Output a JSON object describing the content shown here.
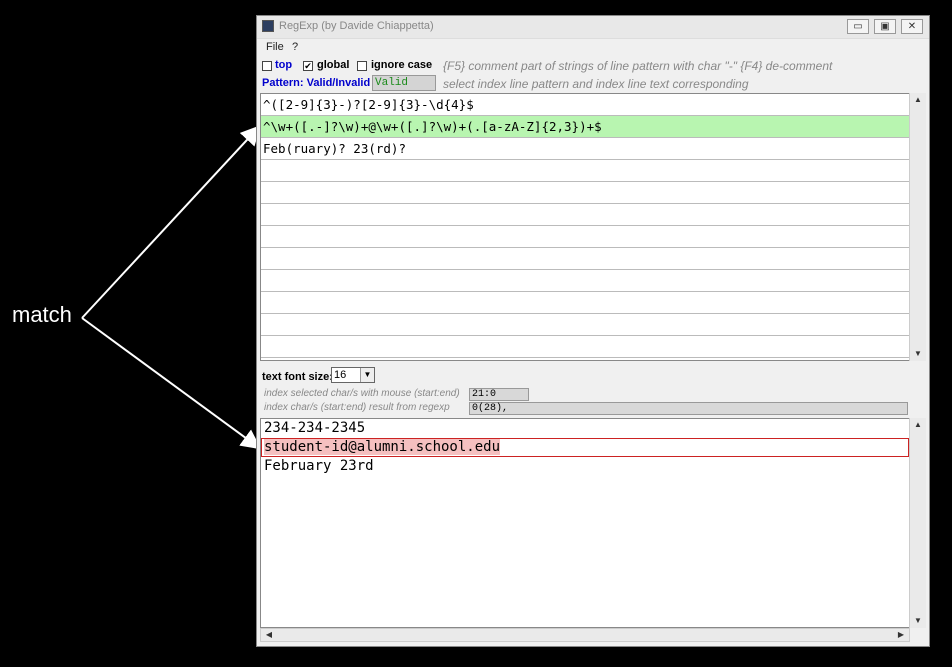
{
  "annotation": {
    "label": "match"
  },
  "window": {
    "title": "RegExp (by Davide Chiappetta)",
    "controls": {
      "minimize": "▭",
      "maximize": "▣",
      "close": "✕"
    }
  },
  "menu": {
    "file": "File",
    "help": "?"
  },
  "options": {
    "top": {
      "label": "top",
      "checked": false
    },
    "global": {
      "label": "global",
      "checked": true
    },
    "ignore_case": {
      "label": "ignore case",
      "checked": false
    },
    "hint": "{F5} comment part of strings of line pattern with char \"-\" {F4} de-comment"
  },
  "pattern": {
    "label": "Pattern: Valid/Invalid",
    "status": "Valid",
    "hint": "select index line pattern and index line text  corresponding",
    "rows": [
      "^([2-9]{3}-)?[2-9]{3}-\\d{4}$",
      "^\\w+([.-]?\\w)+@\\w+([.]?\\w)+(.[a-zA-Z]{2,3})+$",
      "Feb(ruary)? 23(rd)?"
    ],
    "selected_index": 1
  },
  "font_size": {
    "label": "text font size:",
    "value": "16"
  },
  "info": {
    "selected_label": "index selected char/s with mouse (start:end)",
    "selected_value": "21:0",
    "result_label": "index char/s (start:end) result from regexp",
    "result_value": "0(28),"
  },
  "text": {
    "rows": [
      "234-234-2345",
      "student-id@alumni.school.edu",
      "February 23rd"
    ],
    "matched_index": 1
  },
  "colors": {
    "valid_text": "#1a8a1a",
    "selected_pattern_bg": "#b8f5b0",
    "match_highlight": "#f5c0c0",
    "match_border": "#cc2222",
    "pattern_label": "#0000cc"
  }
}
